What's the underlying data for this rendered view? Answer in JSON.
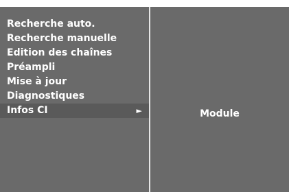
{
  "menu": {
    "items": [
      {
        "label": "Recherche auto."
      },
      {
        "label": "Recherche manuelle"
      },
      {
        "label": "Edition des chaînes"
      },
      {
        "label": "Préampli"
      },
      {
        "label": "Mise à jour"
      },
      {
        "label": "Diagnostiques"
      },
      {
        "label": "Infos CI",
        "arrow": "►"
      }
    ],
    "selected_index": 6
  },
  "submenu": {
    "item": "Module"
  },
  "colors": {
    "panel_bg": "#6a6a6a",
    "divider": "#e6e6e6",
    "text": "#ffffff"
  },
  "icons": {
    "submenu_arrow": "right-triangle-arrow-icon"
  }
}
